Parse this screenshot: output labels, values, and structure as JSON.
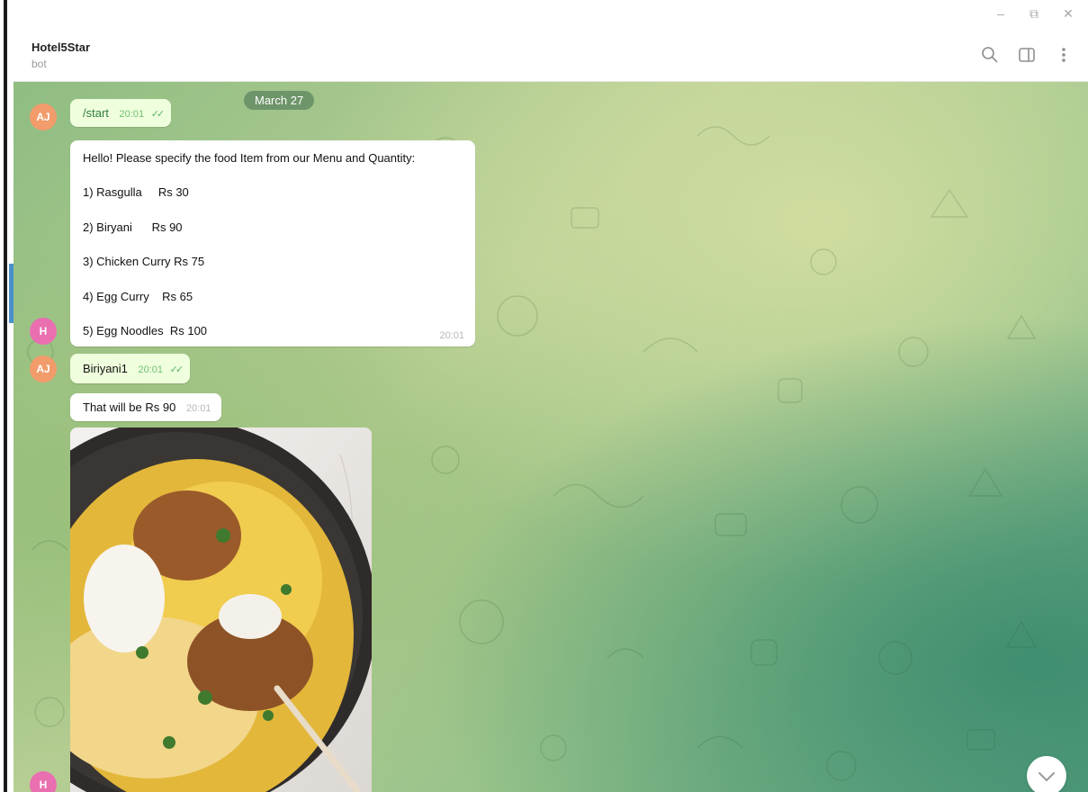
{
  "window": {
    "minimize": "–",
    "restore": "⧉",
    "close": "✕"
  },
  "header": {
    "chat_name": "Hotel5Star",
    "status": "bot",
    "icons": [
      "search-icon",
      "sidebar-toggle-icon",
      "more-vertical-icon"
    ]
  },
  "chat": {
    "date": "March 27",
    "messages": [
      {
        "type": "outgoing",
        "avatar": "AJ",
        "text": "/start",
        "time": "20:01",
        "read": true
      },
      {
        "type": "incoming",
        "avatar": "H",
        "intro": "Hello! Please specify the food Item from our Menu and Quantity:",
        "items": [
          "1) Rasgulla     Rs 30",
          "2) Biryani      Rs 90",
          "3) Chicken Curry Rs 75",
          "4) Egg Curry    Rs 65",
          "5) Egg Noodles  Rs 100"
        ],
        "time": "20:01"
      },
      {
        "type": "outgoing",
        "avatar": "AJ",
        "text": "Biriyani1",
        "time": "20:01",
        "read": true
      },
      {
        "type": "incoming",
        "avatar": "H",
        "text": "That will be Rs 90",
        "time": "20:01"
      },
      {
        "type": "incoming-photo",
        "avatar": "H",
        "photo": "biryani-dish-photo"
      }
    ]
  },
  "colors": {
    "outgoing_bubble": "#effedd",
    "incoming_bubble": "#ffffff",
    "avatar_aj": "#f29b6b",
    "avatar_h": "#e96fb0",
    "date_pill": "#6e8f6a"
  }
}
